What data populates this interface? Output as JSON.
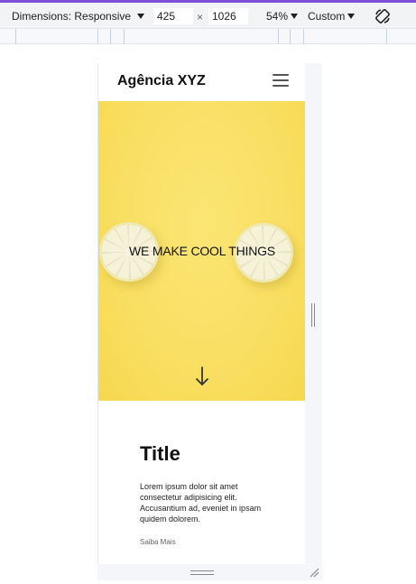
{
  "devtools": {
    "dimensions_label": "Dimensions: Responsive",
    "width_value": "425",
    "height_value": "1026",
    "times": "×",
    "zoom": "54%",
    "throttle": "Custom",
    "accent_color": "#7b4fd6"
  },
  "site": {
    "brand": "Agência XYZ",
    "hero_title": "WE MAKE COOL THINGS",
    "hero_color": "#f9df63",
    "card": {
      "title": "Title",
      "text": "Lorem ipsum dolor sit amet consectetur adipisicing elit. Accusantium ad, eveniet in ipsam quidem dolorem.",
      "link": "Saiba Mais"
    }
  },
  "icons": {
    "menu": "hamburger-icon",
    "arrow": "arrow-down-icon",
    "rotate": "rotate-icon"
  }
}
